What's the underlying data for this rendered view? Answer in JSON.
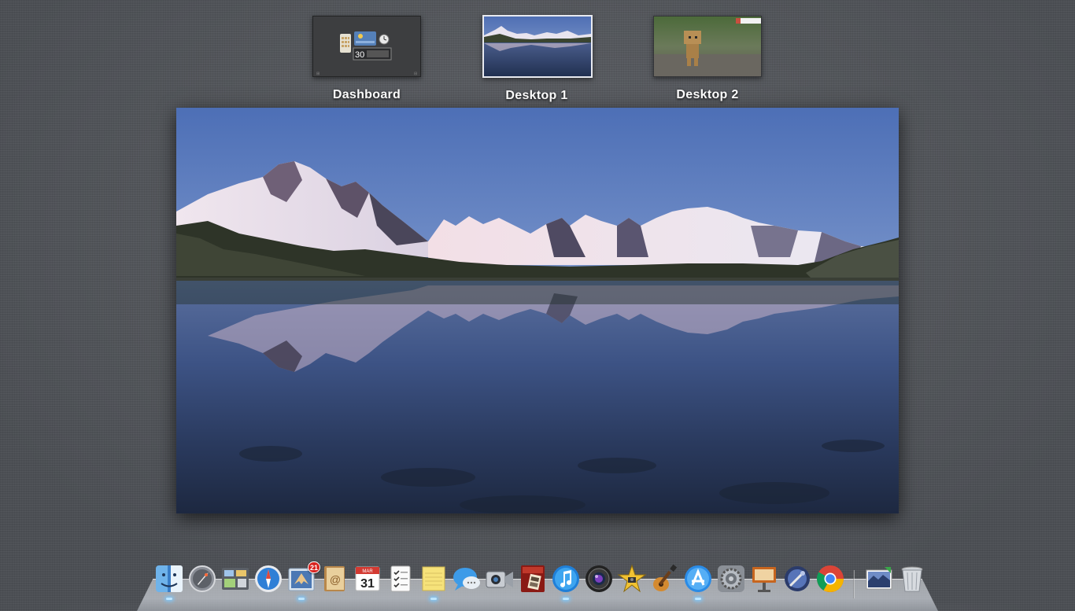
{
  "spaces": [
    {
      "id": "dashboard",
      "label": "Dashboard",
      "selected": false,
      "widget_day": "30"
    },
    {
      "id": "desktop1",
      "label": "Desktop 1",
      "selected": true
    },
    {
      "id": "desktop2",
      "label": "Desktop 2",
      "selected": false
    }
  ],
  "dock": {
    "items": [
      {
        "name": "Finder",
        "icon": "finder-icon",
        "running": true
      },
      {
        "name": "Launchpad",
        "icon": "launchpad-icon",
        "running": false
      },
      {
        "name": "Mission Control",
        "icon": "mission-control-icon",
        "running": false
      },
      {
        "name": "Safari",
        "icon": "safari-icon",
        "running": false
      },
      {
        "name": "Mail",
        "icon": "mail-icon",
        "running": true,
        "badge": "21"
      },
      {
        "name": "Contacts",
        "icon": "contacts-icon",
        "running": false
      },
      {
        "name": "Calendar",
        "icon": "calendar-icon",
        "running": false,
        "month": "MAR",
        "day": "31"
      },
      {
        "name": "Reminders",
        "icon": "reminders-icon",
        "running": false
      },
      {
        "name": "Notes",
        "icon": "notes-icon",
        "running": true
      },
      {
        "name": "Messages",
        "icon": "messages-icon",
        "running": false
      },
      {
        "name": "FaceTime",
        "icon": "facetime-icon",
        "running": false
      },
      {
        "name": "Photo Booth",
        "icon": "photo-booth-icon",
        "running": false
      },
      {
        "name": "iTunes",
        "icon": "itunes-icon",
        "running": true
      },
      {
        "name": "Aperture",
        "icon": "camera-lens-icon",
        "running": false
      },
      {
        "name": "iMovie",
        "icon": "imovie-icon",
        "running": false
      },
      {
        "name": "GarageBand",
        "icon": "garageband-icon",
        "running": false
      },
      {
        "name": "App Store",
        "icon": "app-store-icon",
        "running": true
      },
      {
        "name": "System Preferences",
        "icon": "system-preferences-icon",
        "running": false
      },
      {
        "name": "Keynote",
        "icon": "keynote-icon",
        "running": false
      },
      {
        "name": "Preview",
        "icon": "preview-icon",
        "running": false
      },
      {
        "name": "Chrome",
        "icon": "chrome-icon",
        "running": false
      },
      {
        "name": "Downloads stack",
        "icon": "image-file-icon",
        "running": false
      },
      {
        "name": "Trash",
        "icon": "trash-icon",
        "running": false
      }
    ]
  },
  "colors": {
    "background": "#54575c",
    "selection_border": "#e8eaf0",
    "running_indicator": "#bfe6ff",
    "badge": "#d8231f"
  }
}
